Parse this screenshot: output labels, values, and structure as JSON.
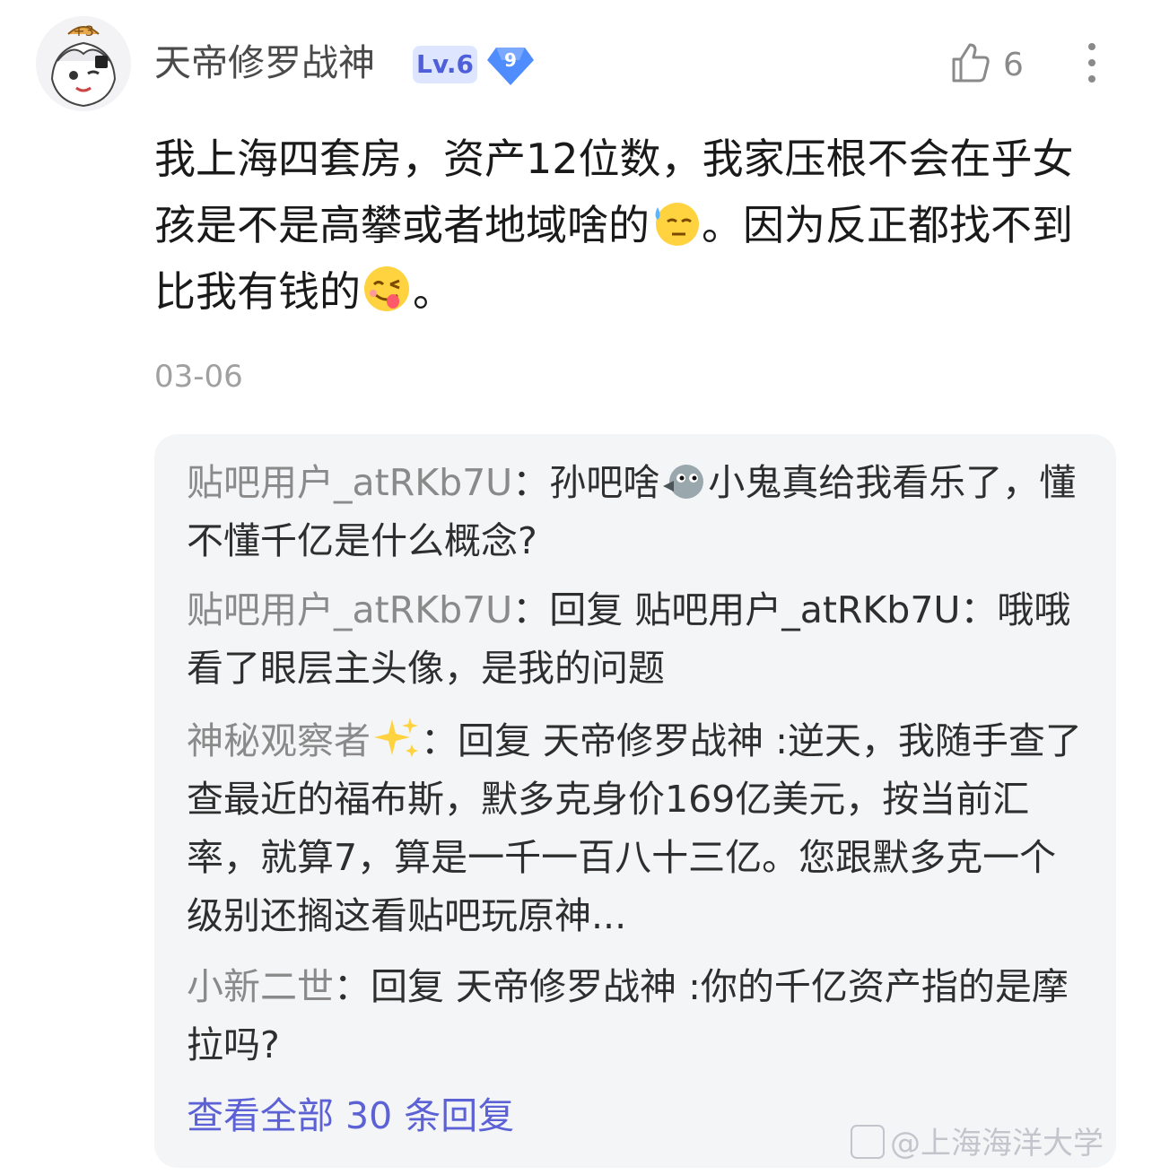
{
  "post": {
    "username": "天帝修罗战神",
    "level": "Lv.6",
    "gem_level": "9",
    "like_count": "6",
    "content_before_emoji1": "我上海四套房，资产12位数，我家压根不会在乎女孩是不是高攀或者地域啥的",
    "content_between": "。因为反正都找不到比我有钱的",
    "content_end": "。",
    "date": "03-06"
  },
  "replies": [
    {
      "author": "贴吧用户_atRKb7U",
      "text_a": "：孙吧啥",
      "text_b": "小鬼真给我看乐了，懂不懂千亿是什么概念?"
    },
    {
      "author": "贴吧用户_atRKb7U",
      "text": "：回复 贴吧用户_atRKb7U：哦哦看了眼层主头像，是我的问题"
    },
    {
      "author": "神秘观察者",
      "text": "：回复 天帝修罗战神 :逆天，我随手查了查最近的福布斯，默多克身价169亿美元，按当前汇率，就算7，算是一千一百八十三亿。您跟默多克一个级别还搁这看贴吧玩原神..."
    },
    {
      "author": "小新二世",
      "text": "：回复 天帝修罗战神 :你的千亿资产指的是摩拉吗?"
    }
  ],
  "view_all": "查看全部 30 条回复",
  "watermark": "@上海海洋大学",
  "icons": {
    "like": "thumbs-up-icon",
    "more": "more-vertical-icon",
    "gem": "diamond-icon",
    "emoji1": "sweat-smile-emoji",
    "emoji2": "tongue-emoji",
    "inline1": "bird-face-icon",
    "inline2": "sparkles-icon"
  },
  "colors": {
    "link": "#5c62d6",
    "author": "#8a8a8a",
    "badge_bg": "#dde5ff",
    "badge_text": "#4f5fd9",
    "gem": "#4f8dff"
  }
}
